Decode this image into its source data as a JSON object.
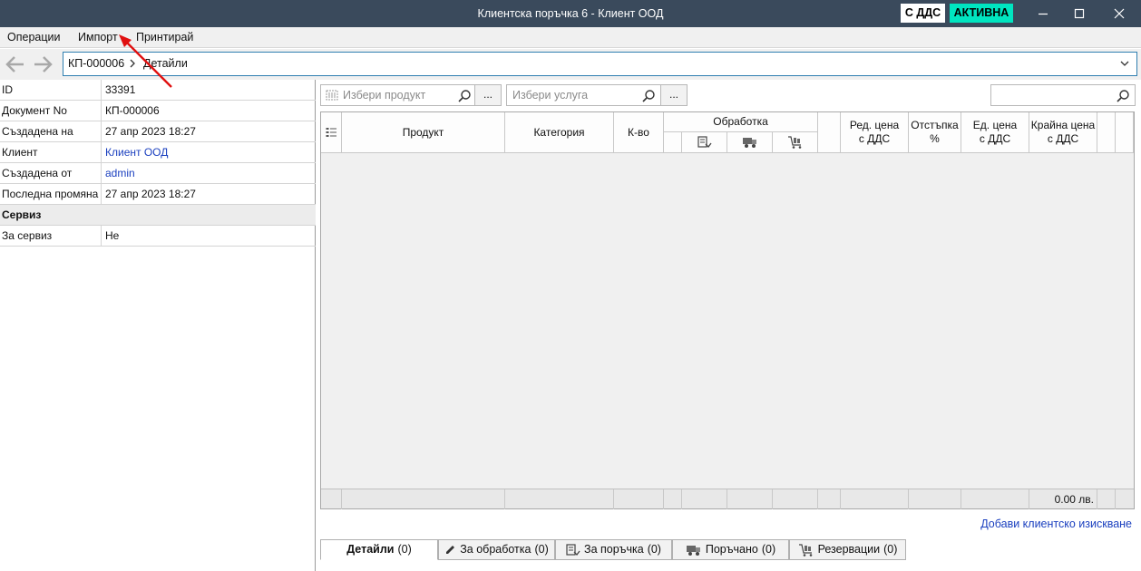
{
  "window": {
    "title": "Клиентска поръчка 6 - Клиент ООД",
    "vat_badge": "С ДДС",
    "status_badge": "АКТИВНА",
    "colors": {
      "titlebar": "#3a4a5c",
      "status_badge": "#00e5c0",
      "link": "#1a3fbf"
    }
  },
  "menu": {
    "items": [
      "Операции",
      "Импорт",
      "Принтирай"
    ]
  },
  "breadcrumb": {
    "root": "КП-000006",
    "current": "Детайли"
  },
  "properties": {
    "rows": [
      {
        "key": "ID",
        "value": "33391"
      },
      {
        "key": "Документ No",
        "value": "КП-000006"
      },
      {
        "key": "Създадена на",
        "value": "27 апр 2023 18:27"
      },
      {
        "key": "Клиент",
        "value": "Клиент ООД"
      },
      {
        "key": "Създадена от",
        "value": "admin"
      },
      {
        "key": "Последна промяна",
        "value": "27 апр 2023 18:27"
      }
    ],
    "section": "Сервиз",
    "service_row": {
      "key": "За сервиз",
      "value": "Не"
    }
  },
  "search": {
    "product_placeholder": "Избери продукт",
    "service_placeholder": "Избери услуга",
    "browse_label": "...",
    "global_value": ""
  },
  "grid": {
    "columns": {
      "product": "Продукт",
      "category": "Категория",
      "qty": "К-во",
      "processing": "Обработка",
      "price_line1": "Ред. цена",
      "price_line2": "с ДДС",
      "discount_line1": "Отстъпка",
      "discount_line2": "%",
      "unit_line1": "Ед. цена",
      "unit_line2": "с ДДС",
      "final_line1": "Крайна цена",
      "final_line2": "с ДДС"
    },
    "total": "0.00 лв."
  },
  "add_request_link": "Добави клиентско изискване",
  "tabs": [
    {
      "label": "Детайли",
      "count": "(0)",
      "icon": ""
    },
    {
      "label": "За обработка",
      "count": "(0)",
      "icon": "pencil-icon"
    },
    {
      "label": "За поръчка",
      "count": "(0)",
      "icon": "order-icon"
    },
    {
      "label": "Поръчано",
      "count": "(0)",
      "icon": "truck-icon"
    },
    {
      "label": "Резервации",
      "count": "(0)",
      "icon": "cart-icon"
    }
  ]
}
